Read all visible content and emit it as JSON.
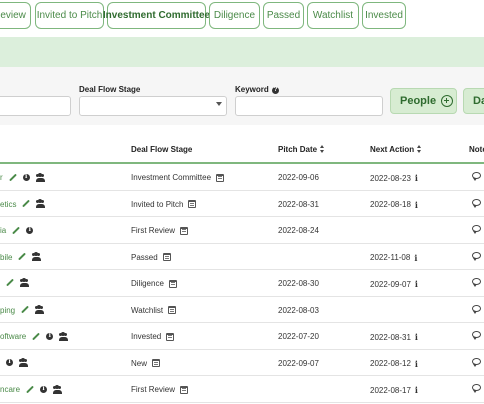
{
  "tabs": [
    {
      "label": "Review",
      "active": false
    },
    {
      "label": "Invited to Pitch",
      "active": false
    },
    {
      "label": "Investment Committee",
      "active": true
    },
    {
      "label": "Diligence",
      "active": false
    },
    {
      "label": "Passed",
      "active": false
    },
    {
      "label": "Watchlist",
      "active": false
    },
    {
      "label": "Invested",
      "active": false
    }
  ],
  "filters": {
    "deal_flow_stage_label": "Deal Flow Stage",
    "keyword_label": "Keyword",
    "people_button": "People",
    "next_button": "Da"
  },
  "table": {
    "headers": {
      "deal_flow_stage": "Deal Flow Stage",
      "pitch_date": "Pitch Date",
      "next_action": "Next Action",
      "notes": "Note"
    },
    "rows": [
      {
        "name": "r",
        "icons": [
          "pencil",
          "info",
          "users"
        ],
        "stage": "Investment Committee",
        "pitch_date": "2022-09-06",
        "next_action": "2022-08-23"
      },
      {
        "name": "etics",
        "icons": [
          "pencil",
          "users"
        ],
        "stage": "Invited to Pitch",
        "pitch_date": "2022-08-31",
        "next_action": "2022-08-18"
      },
      {
        "name": "ia",
        "icons": [
          "pencil",
          "info"
        ],
        "stage": "First Review",
        "pitch_date": "2022-08-24",
        "next_action": ""
      },
      {
        "name": "bile",
        "icons": [
          "pencil",
          "users"
        ],
        "stage": "Passed",
        "pitch_date": "",
        "next_action": "2022-11-08"
      },
      {
        "name": "",
        "icons": [
          "pencil",
          "users"
        ],
        "stage": "Diligence",
        "pitch_date": "2022-08-30",
        "next_action": "2022-09-07"
      },
      {
        "name": "ping",
        "icons": [
          "pencil",
          "users"
        ],
        "stage": "Watchlist",
        "pitch_date": "2022-08-03",
        "next_action": ""
      },
      {
        "name": "oftware",
        "icons": [
          "pencil",
          "info",
          "users"
        ],
        "stage": "Invested",
        "pitch_date": "2022-07-20",
        "next_action": "2022-08-31"
      },
      {
        "name": "",
        "icons": [
          "info",
          "users"
        ],
        "stage": "New",
        "pitch_date": "2022-09-07",
        "next_action": "2022-08-12"
      },
      {
        "name": "ncare",
        "icons": [
          "pencil",
          "info",
          "users"
        ],
        "stage": "First Review",
        "pitch_date": "",
        "next_action": "2022-08-17"
      }
    ]
  }
}
